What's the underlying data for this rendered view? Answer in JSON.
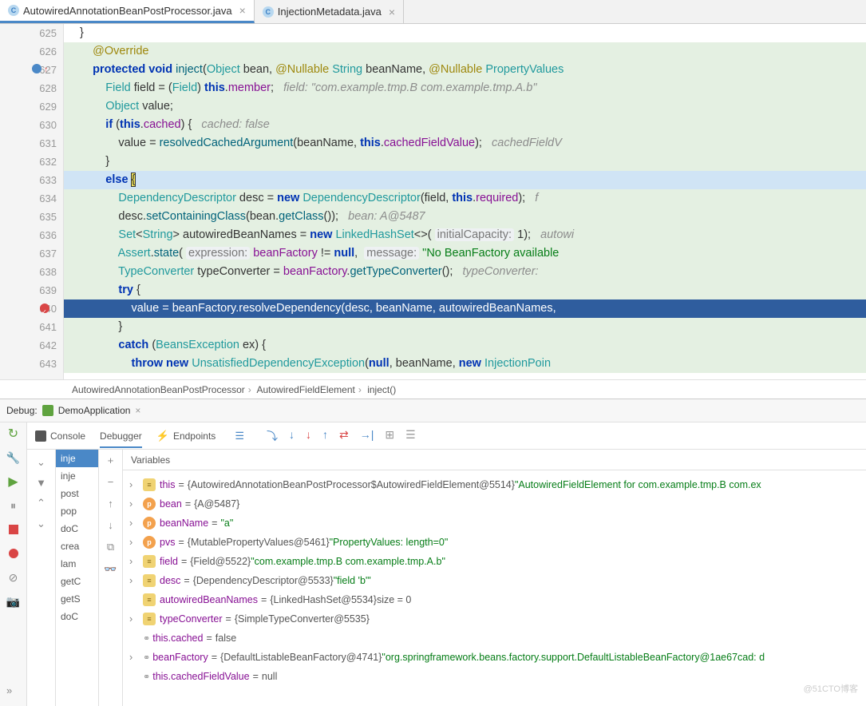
{
  "tabs": [
    {
      "icon": "C",
      "label": "AutowiredAnnotationBeanPostProcessor.java",
      "active": true
    },
    {
      "icon": "C",
      "label": "InjectionMetadata.java",
      "active": false
    }
  ],
  "gutter": [
    "625",
    "626",
    "627",
    "628",
    "629",
    "630",
    "631",
    "632",
    "633",
    "634",
    "635",
    "636",
    "637",
    "638",
    "639",
    "640",
    "641",
    "642",
    "643"
  ],
  "breadcrumb": [
    "AutowiredAnnotationBeanPostProcessor",
    "AutowiredFieldElement",
    "inject()"
  ],
  "code_hints": {
    "field_comment": "field: \"com.example.tmp.B com.example.tmp.A.b\"",
    "cached_comment": "cached: false",
    "cached_field_comment": "cachedFieldV",
    "bean_comment": "bean: A@5487",
    "capacity_hint": "initialCapacity:",
    "capacity_val": "1",
    "autowi_comment": "autowi",
    "expr_hint": "expression:",
    "msg_hint": "message:",
    "msg_str": "\"No BeanFactory available",
    "typeconv_comment": "typeConverter:"
  },
  "debug": {
    "label": "Debug:",
    "run_config": "DemoApplication",
    "tabs": {
      "console": "Console",
      "debugger": "Debugger",
      "endpoints": "Endpoints"
    },
    "vars_header": "Variables",
    "frames": [
      "inje",
      "inje",
      "post",
      "pop",
      "doC",
      "crea",
      "lam",
      "getC",
      "getS",
      "doC"
    ],
    "variables": [
      {
        "icon": "eq",
        "expand": true,
        "name": "this",
        "val": "{AutowiredAnnotationBeanPostProcessor$AutowiredFieldElement@5514}",
        "str": "\"AutowiredFieldElement for com.example.tmp.B com.ex"
      },
      {
        "icon": "p",
        "expand": true,
        "name": "bean",
        "val": "{A@5487}",
        "str": ""
      },
      {
        "icon": "p",
        "expand": true,
        "name": "beanName",
        "val": "",
        "str": "\"a\""
      },
      {
        "icon": "p",
        "expand": true,
        "name": "pvs",
        "val": "{MutablePropertyValues@5461}",
        "str": "\"PropertyValues: length=0\""
      },
      {
        "icon": "eq",
        "expand": true,
        "name": "field",
        "val": "{Field@5522}",
        "str": "\"com.example.tmp.B com.example.tmp.A.b\""
      },
      {
        "icon": "eq",
        "expand": true,
        "name": "desc",
        "val": "{DependencyDescriptor@5533}",
        "str": "\"field 'b'\""
      },
      {
        "icon": "eq",
        "expand": false,
        "name": "autowiredBeanNames",
        "val": "{LinkedHashSet@5534}",
        "extra": "  size = 0"
      },
      {
        "icon": "eq",
        "expand": true,
        "name": "typeConverter",
        "val": "{SimpleTypeConverter@5535}",
        "str": ""
      },
      {
        "icon": "oo",
        "expand": false,
        "name": "this.cached",
        "plain": "false"
      },
      {
        "icon": "oo",
        "expand": true,
        "name": "beanFactory",
        "val": "{DefaultListableBeanFactory@4741}",
        "str": "\"org.springframework.beans.factory.support.DefaultListableBeanFactory@1ae67cad: d"
      },
      {
        "icon": "oo",
        "expand": false,
        "name": "this.cachedFieldValue",
        "plain": "null"
      }
    ]
  },
  "watermark": "@51CTO博客"
}
